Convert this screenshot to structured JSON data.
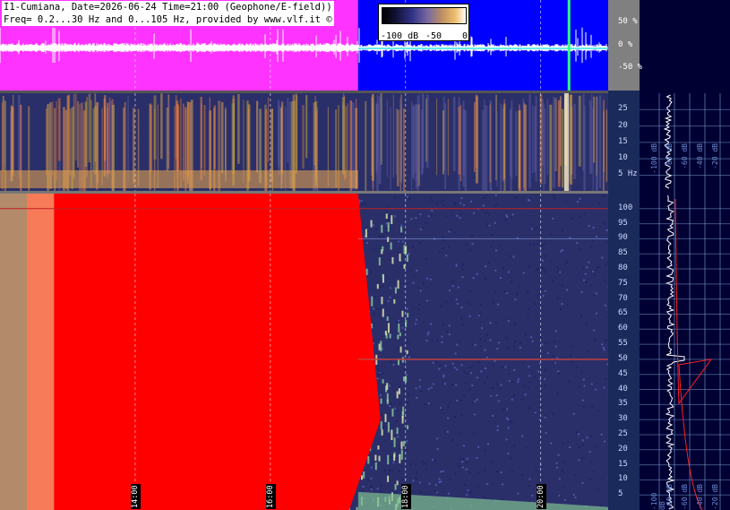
{
  "header": {
    "line1": "I1-Cumiana, Date=2026-06-24 Time=21:00 (Geophone/E-field))",
    "line2": "Freq= 0.2...30 Hz and 0...105 Hz, provided by www.vlf.it ©"
  },
  "colors": {
    "magenta": "#ff33ff",
    "blue": "#0000ff",
    "red": "#ff0000",
    "spec_bg": "#2a2f6a",
    "sidebar_bg": "#000033",
    "grid": "#7f9fd0"
  },
  "chart_data": [
    {
      "type": "line",
      "name": "waveform",
      "y_ticks": [
        "50 %",
        "0 %",
        "-50 %"
      ],
      "y_values": [
        50,
        0,
        -50
      ],
      "ylim": [
        -100,
        100
      ]
    },
    {
      "type": "heatmap",
      "name": "spectrogram-0.2-30Hz",
      "y_ticks": [
        "25",
        "20",
        "15",
        "10",
        "5 Hz"
      ],
      "y_values": [
        25,
        20,
        15,
        10,
        5
      ],
      "ylim": [
        0.2,
        30
      ]
    },
    {
      "type": "heatmap",
      "name": "spectrogram-0-105Hz",
      "y_ticks": [
        "100",
        "95",
        "90",
        "85",
        "80",
        "75",
        "70",
        "65",
        "60",
        "55",
        "50",
        "45",
        "40",
        "35",
        "30",
        "25",
        "20",
        "15",
        "10",
        "5"
      ],
      "y_values": [
        100,
        95,
        90,
        85,
        80,
        75,
        70,
        65,
        60,
        55,
        50,
        45,
        40,
        35,
        30,
        25,
        20,
        15,
        10,
        5
      ],
      "ylim": [
        0,
        105
      ],
      "x_ticks": [
        "14:00",
        "16:00",
        "18:00",
        "20:00"
      ],
      "x_values": [
        14,
        16,
        18,
        20
      ],
      "xlim": [
        12.0,
        21.0
      ],
      "saturated_until_hour": 17.3
    },
    {
      "type": "line",
      "name": "spectrum-profile",
      "x_ticks": [
        "-100 dB",
        "-80 dB",
        "-60 dB",
        "-40 dB",
        "-20 dB"
      ],
      "x_values": [
        -100,
        -80,
        -60,
        -40,
        -20
      ]
    }
  ],
  "legend": {
    "ticks": [
      "-100 dB",
      "-50",
      "0"
    ]
  }
}
